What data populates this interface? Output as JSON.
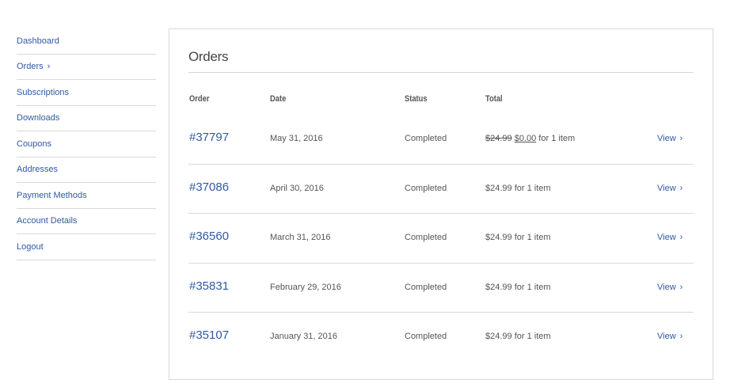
{
  "sidebar": {
    "items": [
      {
        "label": "Dashboard"
      },
      {
        "label": "Orders",
        "chevron": "›"
      },
      {
        "label": "Subscriptions"
      },
      {
        "label": "Downloads"
      },
      {
        "label": "Coupons"
      },
      {
        "label": "Addresses"
      },
      {
        "label": "Payment Methods"
      },
      {
        "label": "Account Details"
      },
      {
        "label": "Logout"
      }
    ]
  },
  "orders": {
    "title": "Orders",
    "columns": {
      "order": "Order",
      "date": "Date",
      "status": "Status",
      "total": "Total"
    },
    "view_label": "View",
    "view_chevron": "›",
    "rows": [
      {
        "number": "#37797",
        "date": "May 31, 2016",
        "status": "Completed",
        "old_price": "$24.99",
        "price": "$0.00",
        "total_suffix": " for 1 item"
      },
      {
        "number": "#37086",
        "date": "April 30, 2016",
        "status": "Completed",
        "total": "$24.99 for 1 item"
      },
      {
        "number": "#36560",
        "date": "March 31, 2016",
        "status": "Completed",
        "total": "$24.99 for 1 item"
      },
      {
        "number": "#35831",
        "date": "February 29, 2016",
        "status": "Completed",
        "total": "$24.99 for 1 item"
      },
      {
        "number": "#35107",
        "date": "January 31, 2016",
        "status": "Completed",
        "total": "$24.99 for 1 item"
      }
    ]
  },
  "colors": {
    "link": "#2f5aa3",
    "text": "#555555",
    "border": "#d8d8d8"
  }
}
